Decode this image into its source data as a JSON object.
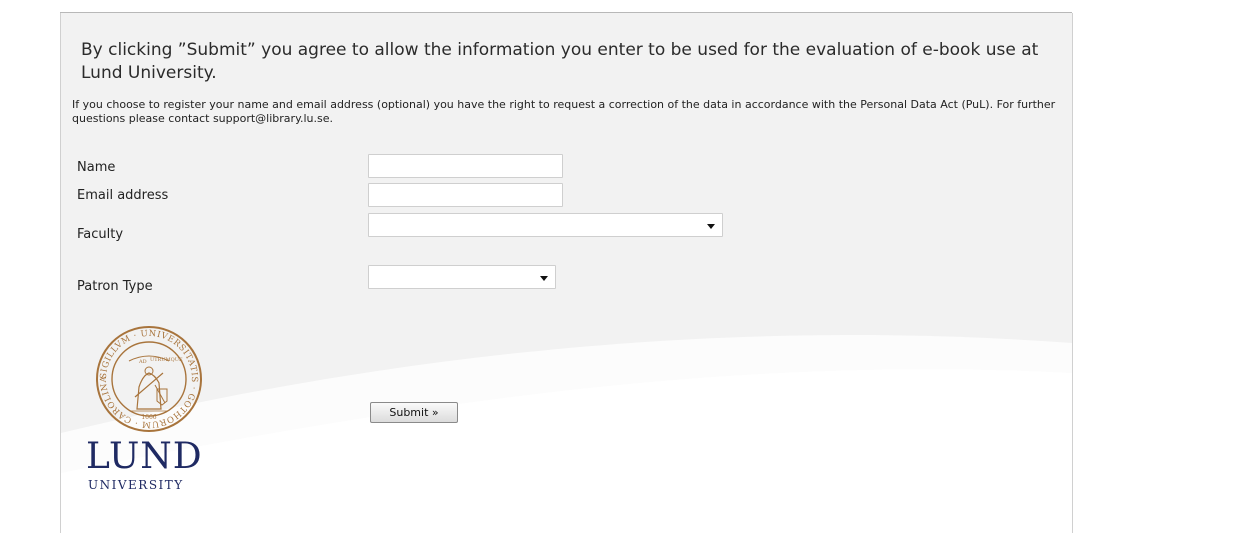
{
  "heading": "By clicking ”Submit” you agree to allow the information you enter to be used for the evaluation of e-book use at Lund University.",
  "notice": "If you choose to register your name and email address (optional) you have the right to request a correction of the data in accordance with the Personal Data Act (PuL). For further questions please contact support@library.lu.se.",
  "form": {
    "name_label": "Name",
    "name_value": "",
    "email_label": "Email address",
    "email_value": "",
    "faculty_label": "Faculty",
    "faculty_selected": "",
    "patron_label": "Patron Type",
    "patron_selected": "",
    "submit_label": "Submit »"
  },
  "logo": {
    "wordmark_line1": "LUND",
    "wordmark_line2": "UNIVERSITY",
    "seal_text": "SIGILLVM UNIVERSITATIS GOTHORUM CAROLINAE",
    "seal_motto": "AD UTRUMQUE",
    "seal_year": "1666",
    "brand_color": "#1f2a63",
    "seal_color": "#a8743c"
  },
  "colors": {
    "panel_background": "#f2f2f2",
    "page_background": "#ffffff"
  }
}
